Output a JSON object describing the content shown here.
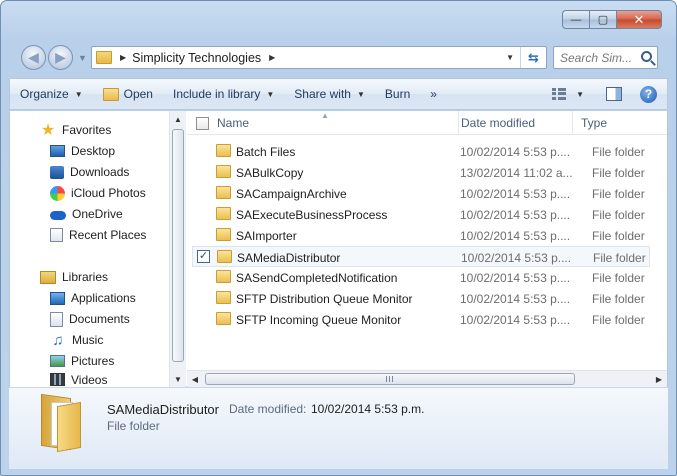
{
  "window": {
    "minimize_glyph": "—",
    "maximize_glyph": "▢",
    "close_glyph": "✕"
  },
  "nav": {
    "back_glyph": "◀",
    "forward_glyph": "▶",
    "history_glyph": "▼"
  },
  "address": {
    "separator": "▶",
    "path": "Simplicity Technologies",
    "trailing_separator": "▶",
    "dropdown_glyph": "▼",
    "refresh_glyph": "⇆"
  },
  "search": {
    "placeholder": "Search Sim..."
  },
  "toolbar": {
    "organize": "Organize",
    "open": "Open",
    "include_in_library": "Include in library",
    "share_with": "Share with",
    "burn": "Burn",
    "more": "»",
    "help": "?"
  },
  "sidebar": {
    "favorites_label": "Favorites",
    "favorites": [
      {
        "label": "Desktop",
        "icon": "desktop-icon"
      },
      {
        "label": "Downloads",
        "icon": "downloads-icon"
      },
      {
        "label": "iCloud Photos",
        "icon": "icloud-icon"
      },
      {
        "label": "OneDrive",
        "icon": "onedrive-icon"
      },
      {
        "label": "Recent Places",
        "icon": "recent-icon"
      }
    ],
    "libraries_label": "Libraries",
    "libraries": [
      {
        "label": "Applications",
        "icon": "applications-icon"
      },
      {
        "label": "Documents",
        "icon": "documents-icon"
      },
      {
        "label": "Music",
        "icon": "music-icon"
      },
      {
        "label": "Pictures",
        "icon": "pictures-icon"
      },
      {
        "label": "Videos",
        "icon": "videos-icon"
      }
    ]
  },
  "filelist": {
    "columns": {
      "name": "Name",
      "date": "Date modified",
      "type": "Type"
    },
    "rows": [
      {
        "name": "Batch Files",
        "date": "10/02/2014 5:53 p....",
        "type": "File folder",
        "selected": false
      },
      {
        "name": "SABulkCopy",
        "date": "13/02/2014 11:02 a...",
        "type": "File folder",
        "selected": false
      },
      {
        "name": "SACampaignArchive",
        "date": "10/02/2014 5:53 p....",
        "type": "File folder",
        "selected": false
      },
      {
        "name": "SAExecuteBusinessProcess",
        "date": "10/02/2014 5:53 p....",
        "type": "File folder",
        "selected": false
      },
      {
        "name": "SAImporter",
        "date": "10/02/2014 5:53 p....",
        "type": "File folder",
        "selected": false
      },
      {
        "name": "SAMediaDistributor",
        "date": "10/02/2014 5:53 p....",
        "type": "File folder",
        "selected": true
      },
      {
        "name": "SASendCompletedNotification",
        "date": "10/02/2014 5:53 p....",
        "type": "File folder",
        "selected": false
      },
      {
        "name": "SFTP Distribution Queue Monitor",
        "date": "10/02/2014 5:53 p....",
        "type": "File folder",
        "selected": false
      },
      {
        "name": "SFTP Incoming Queue Monitor",
        "date": "10/02/2014 5:53 p....",
        "type": "File folder",
        "selected": false
      }
    ],
    "check_glyph": "✓"
  },
  "details": {
    "name": "SAMediaDistributor",
    "date_label": "Date modified:",
    "date_value": "10/02/2014 5:53 p.m.",
    "type": "File folder"
  },
  "colors": {
    "accent": "#2c6fb5",
    "title_bg": "#c9dcf2",
    "close_btn": "#c44a2e"
  }
}
